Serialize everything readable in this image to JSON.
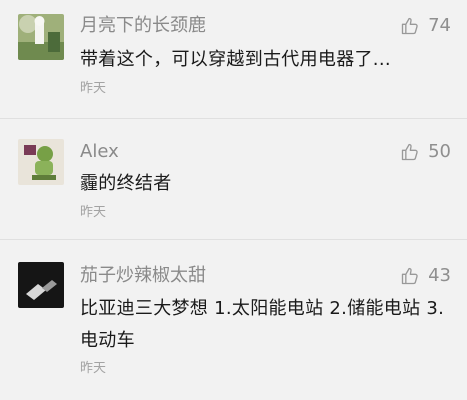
{
  "comments": [
    {
      "username": "月亮下的长颈鹿",
      "likes": "74",
      "text": "带着这个，可以穿越到古代用电器了...",
      "time": "昨天",
      "avatar_icon": "giraffe-photo-icon",
      "like_icon": "thumbs-up-icon"
    },
    {
      "username": "Alex",
      "likes": "50",
      "text": "霾的终结者",
      "time": "昨天",
      "avatar_icon": "toy-figure-photo-icon",
      "like_icon": "thumbs-up-icon"
    },
    {
      "username": "茄子炒辣椒太甜",
      "likes": "43",
      "text": "比亚迪三大梦想 1.太阳能电站 2.储能电站 3.电动车",
      "time": "昨天",
      "avatar_icon": "dark-photo-icon",
      "like_icon": "thumbs-up-icon"
    }
  ],
  "colors": {
    "background": "#f2f2f2",
    "username": "#8a8a8a",
    "text": "#1a1a1a",
    "time": "#a3a3a3"
  }
}
